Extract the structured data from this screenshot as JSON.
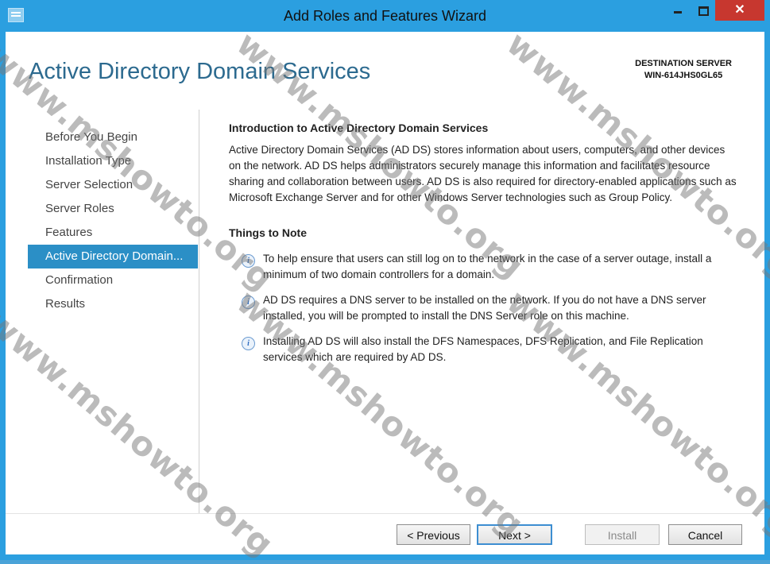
{
  "window": {
    "title": "Add Roles and Features Wizard",
    "close_glyph": "✕"
  },
  "page": {
    "title": "Active Directory Domain Services",
    "destination_label": "DESTINATION SERVER",
    "destination_value": "WIN-614JHS0GL65"
  },
  "nav": {
    "items": [
      {
        "label": "Before You Begin"
      },
      {
        "label": "Installation Type"
      },
      {
        "label": "Server Selection"
      },
      {
        "label": "Server Roles"
      },
      {
        "label": "Features"
      },
      {
        "label": "Active Directory Domain..."
      },
      {
        "label": "Confirmation"
      },
      {
        "label": "Results"
      }
    ]
  },
  "content": {
    "intro_heading": "Introduction to Active Directory Domain Services",
    "intro_text": "Active Directory Domain Services (AD DS) stores information about users, computers, and other devices on the network.  AD DS helps administrators securely manage this information and facilitates resource sharing and collaboration between users.  AD DS is also required for directory-enabled applications such as Microsoft Exchange Server and for other Windows Server technologies such as Group Policy.",
    "notes_heading": "Things to Note",
    "notes": [
      {
        "text": "To help ensure that users can still log on to the network in the case of a server outage, install a minimum of two domain controllers for a domain."
      },
      {
        "text": "AD DS requires a DNS server to be installed on the network.  If you do not have a DNS server installed, you will be prompted to install the DNS Server role on this machine."
      },
      {
        "text": "Installing AD DS will also install the DFS Namespaces, DFS Replication, and File Replication services which are required by AD DS."
      }
    ],
    "info_glyph": "i"
  },
  "footer": {
    "previous": "< Previous",
    "next": "Next >",
    "install": "Install",
    "cancel": "Cancel"
  },
  "watermark": "www.mshowto.org"
}
